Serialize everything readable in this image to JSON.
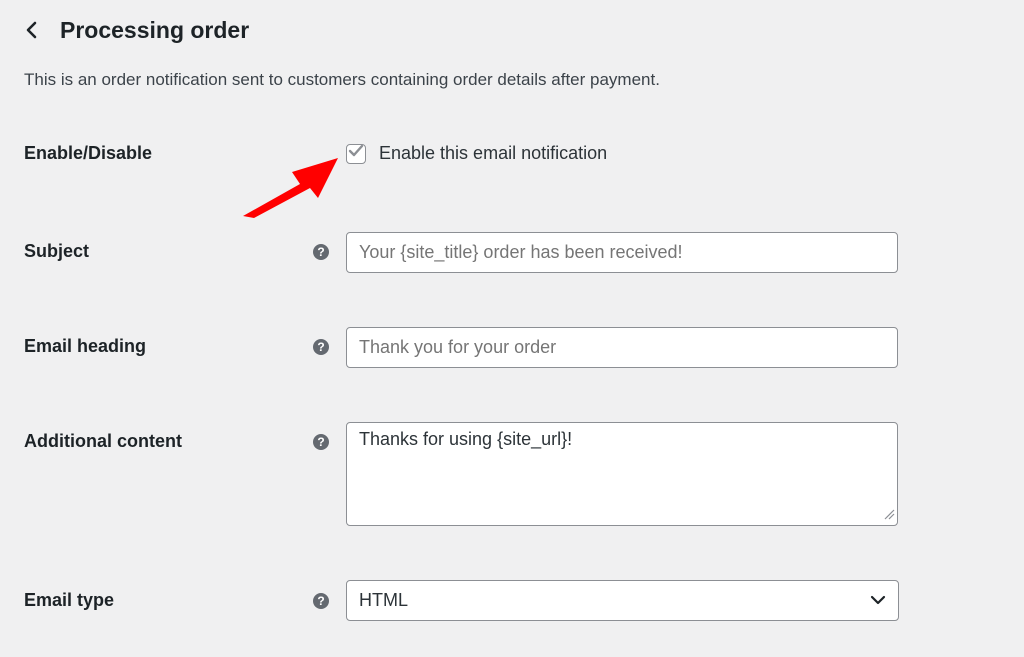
{
  "header": {
    "back_icon": "chevron-left-icon",
    "title": "Processing order"
  },
  "description": "This is an order notification sent to customers containing order details after payment.",
  "enable_row": {
    "label": "Enable/Disable",
    "checkbox_label": "Enable this email notification",
    "checked": true
  },
  "subject_row": {
    "label": "Subject",
    "help_icon": "?",
    "placeholder": "Your {site_title} order has been received!"
  },
  "heading_row": {
    "label": "Email heading",
    "help_icon": "?",
    "placeholder": "Thank you for your order"
  },
  "content_row": {
    "label": "Additional content",
    "help_icon": "?",
    "value": "Thanks for using {site_url}!"
  },
  "type_row": {
    "label": "Email type",
    "help_icon": "?",
    "selected": "HTML"
  },
  "colors": {
    "background": "#f0f0f1",
    "annotation_arrow": "#ff0000",
    "check_mark": "#8c8f94"
  }
}
